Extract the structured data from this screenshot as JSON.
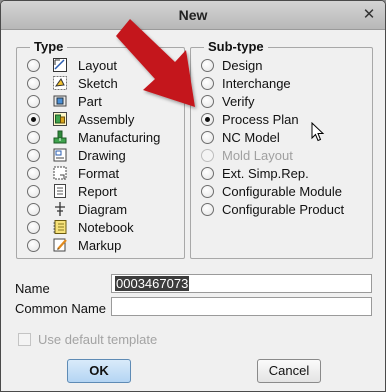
{
  "dialog": {
    "title": "New",
    "close_symbol": "✕"
  },
  "type_group": {
    "label": "Type",
    "items": [
      {
        "label": "Layout",
        "icon": "layout-icon",
        "checked": false
      },
      {
        "label": "Sketch",
        "icon": "sketch-icon",
        "checked": false
      },
      {
        "label": "Part",
        "icon": "part-icon",
        "checked": false
      },
      {
        "label": "Assembly",
        "icon": "assembly-icon",
        "checked": true
      },
      {
        "label": "Manufacturing",
        "icon": "manufacturing-icon",
        "checked": false
      },
      {
        "label": "Drawing",
        "icon": "drawing-icon",
        "checked": false
      },
      {
        "label": "Format",
        "icon": "format-icon",
        "checked": false
      },
      {
        "label": "Report",
        "icon": "report-icon",
        "checked": false
      },
      {
        "label": "Diagram",
        "icon": "diagram-icon",
        "checked": false
      },
      {
        "label": "Notebook",
        "icon": "notebook-icon",
        "checked": false
      },
      {
        "label": "Markup",
        "icon": "markup-icon",
        "checked": false
      }
    ]
  },
  "subtype_group": {
    "label": "Sub-type",
    "items": [
      {
        "label": "Design",
        "checked": false,
        "disabled": false
      },
      {
        "label": "Interchange",
        "checked": false,
        "disabled": false
      },
      {
        "label": "Verify",
        "checked": false,
        "disabled": false
      },
      {
        "label": "Process Plan",
        "checked": true,
        "disabled": false
      },
      {
        "label": "NC Model",
        "checked": false,
        "disabled": false
      },
      {
        "label": "Mold Layout",
        "checked": false,
        "disabled": true
      },
      {
        "label": "Ext. Simp.Rep.",
        "checked": false,
        "disabled": false
      },
      {
        "label": "Configurable Module",
        "checked": false,
        "disabled": false
      },
      {
        "label": "Configurable Product",
        "checked": false,
        "disabled": false
      }
    ]
  },
  "fields": {
    "name_label": "Name",
    "name_value": "0003467073",
    "common_name_label": "Common Name",
    "common_name_value": ""
  },
  "options": {
    "use_default_template_label": "Use default template",
    "use_default_template_checked": false,
    "use_default_template_disabled": true
  },
  "buttons": {
    "ok_label": "OK",
    "cancel_label": "Cancel"
  },
  "colors": {
    "annotation_arrow": "#c4161c",
    "ok_button": "#b4d5f3"
  }
}
